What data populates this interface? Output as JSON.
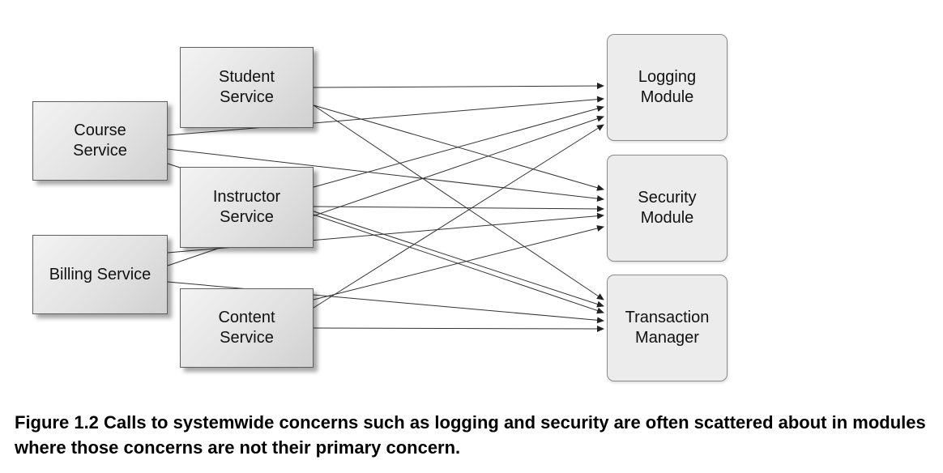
{
  "services": {
    "student": "Student\nService",
    "course": "Course\nService",
    "instructor": "Instructor\nService",
    "billing": "Billing Service",
    "content": "Content\nService"
  },
  "modules": {
    "logging": "Logging\nModule",
    "security": "Security\nModule",
    "transaction": "Transaction\nManager"
  },
  "caption": "Figure 1.2 Calls to systemwide concerns such as logging and security are often scattered about in modules where those concerns are not their primary concern.",
  "connections": [
    {
      "from": "student",
      "to": "logging"
    },
    {
      "from": "student",
      "to": "security"
    },
    {
      "from": "student",
      "to": "transaction"
    },
    {
      "from": "course",
      "to": "logging"
    },
    {
      "from": "course",
      "to": "security"
    },
    {
      "from": "course",
      "to": "transaction"
    },
    {
      "from": "instructor",
      "to": "logging"
    },
    {
      "from": "instructor",
      "to": "security"
    },
    {
      "from": "instructor",
      "to": "transaction"
    },
    {
      "from": "billing",
      "to": "logging"
    },
    {
      "from": "billing",
      "to": "security"
    },
    {
      "from": "billing",
      "to": "transaction"
    },
    {
      "from": "content",
      "to": "logging"
    },
    {
      "from": "content",
      "to": "security"
    },
    {
      "from": "content",
      "to": "transaction"
    }
  ]
}
